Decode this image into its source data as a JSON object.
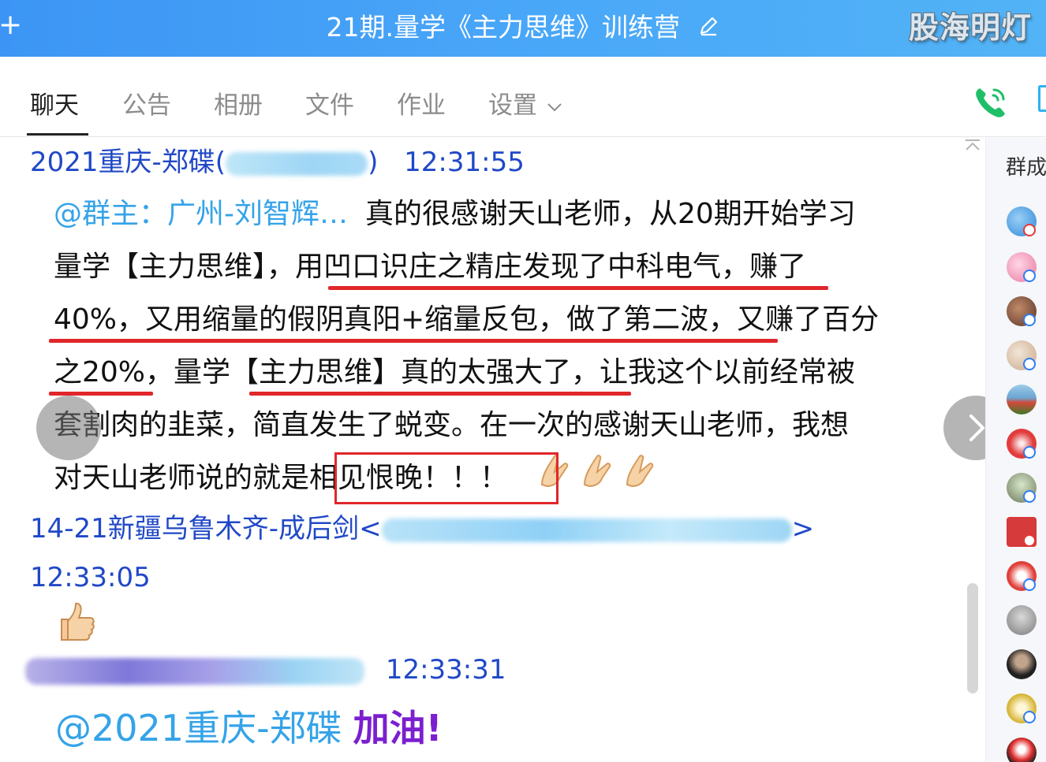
{
  "window": {
    "title": "21期.量学《主力思维》训练营",
    "watermark": "股海明灯"
  },
  "tabs": [
    {
      "label": "聊天",
      "active": true
    },
    {
      "label": "公告",
      "active": false
    },
    {
      "label": "相册",
      "active": false
    },
    {
      "label": "文件",
      "active": false
    },
    {
      "label": "作业",
      "active": false
    },
    {
      "label": "设置",
      "active": false
    }
  ],
  "sidebar": {
    "label": "群成"
  },
  "messages": [
    {
      "sender": "2021重庆-郑碟(",
      "sender_close": ")",
      "time": "12:31:55",
      "mention": "@群主：广州-刘智辉…",
      "lines": [
        "真的很感谢天山老师，从20期开始学习",
        "量学【主力思维】，用凹口识庄之精庄发现了中科电气，赚了",
        "40%，又用缩量的假阴真阳+缩量反包，做了第二波，又赚了百分",
        "之20%，量学【主力思维】真的太强大了，让我这个以前经常被",
        "套割肉的韭菜，简直发生了蜕变。在一次的感谢天山老师，我想",
        "对天山老师说的就是",
        "相见恨晚！！！"
      ]
    },
    {
      "sender": "14-21新疆乌鲁木齐-成后剑<",
      "sender_close": ">",
      "time": "12:33:05"
    },
    {
      "time": "12:33:31",
      "mention": "@2021重庆-郑碟",
      "cheer": "加油!"
    }
  ],
  "colors": {
    "title_bar": "#4aa8f8",
    "sender_blue": "#2048c7",
    "mention_blue": "#35a3e8",
    "highlight_red": "#e0262a",
    "cheer_purple": "#7b1fd0"
  },
  "icons": [
    "edit-icon",
    "chevron-down-icon",
    "phone-icon",
    "collapse-icon",
    "prev-arrow-icon",
    "next-arrow-icon",
    "pray-hands-icon",
    "thumbs-up-icon"
  ]
}
